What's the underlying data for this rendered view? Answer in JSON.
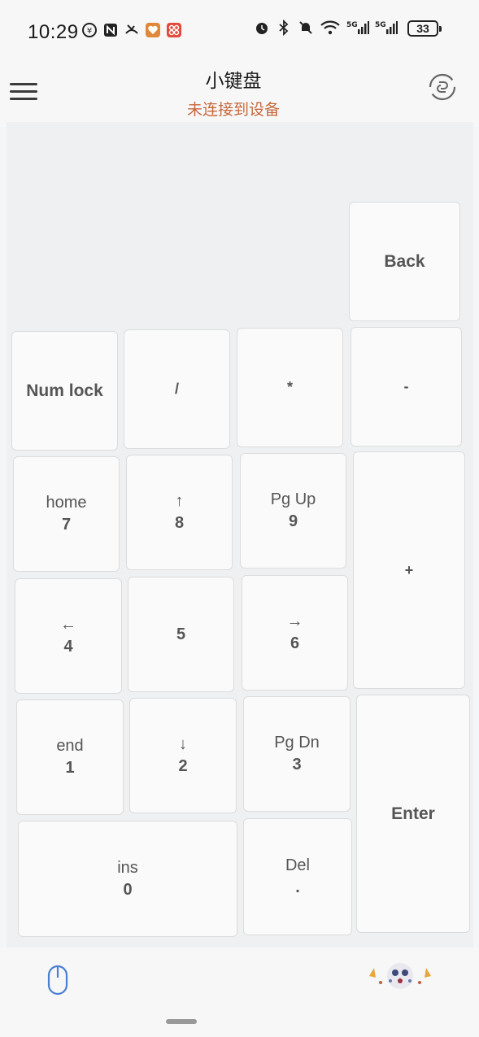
{
  "status_bar": {
    "time": "10:29",
    "battery": "33",
    "left_icons": [
      "currency-icon",
      "nfc-icon",
      "missed-call-icon",
      "health-app-icon",
      "app-icon"
    ],
    "right_icons": [
      "alarm-icon",
      "bluetooth-icon",
      "mute-icon",
      "wifi-icon",
      "signal-5g-icon",
      "signal-5g-icon"
    ]
  },
  "header": {
    "title": "小键盘",
    "subtitle": "未连接到设备",
    "subtitle_color": "#c8683a"
  },
  "keys": {
    "back": "Back",
    "numlock": "Num lock",
    "divide": "/",
    "multiply": "*",
    "minus": "-",
    "k7": {
      "top": "home",
      "bottom": "7"
    },
    "k8": {
      "top": "↑",
      "bottom": "8"
    },
    "k9": {
      "top": "Pg Up",
      "bottom": "9"
    },
    "plus": "+",
    "k4": {
      "top": "←",
      "bottom": "4"
    },
    "k5": "5",
    "k6": {
      "top": "→",
      "bottom": "6"
    },
    "k1": {
      "top": "end",
      "bottom": "1"
    },
    "k2": {
      "top": "↓",
      "bottom": "2"
    },
    "k3": {
      "top": "Pg Dn",
      "bottom": "3"
    },
    "enter": "Enter",
    "k0": {
      "top": "ins",
      "bottom": "0"
    },
    "del": {
      "top": "Del",
      "bottom": "."
    }
  },
  "bottom_bar": {
    "left_icon": "mouse-icon",
    "right_icon": "avatar-icon",
    "accent": "#4a7fd4"
  }
}
